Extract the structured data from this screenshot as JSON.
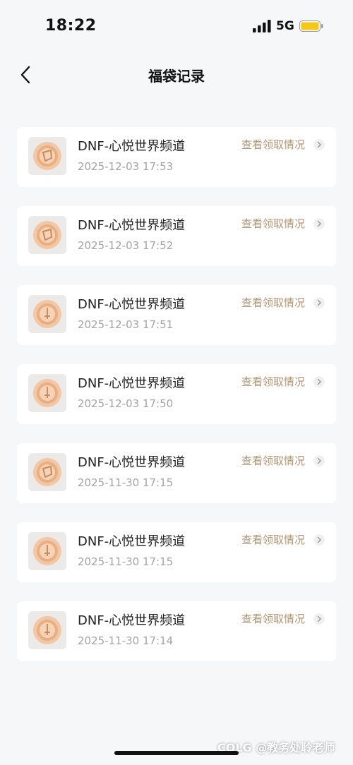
{
  "status_bar": {
    "time": "18:22",
    "network": "5G",
    "icons": [
      "signal-icon",
      "battery-icon"
    ],
    "battery_color": "#f6c61a"
  },
  "nav": {
    "back_icon": "chevron-left-icon",
    "title": "福袋记录"
  },
  "records": [
    {
      "channel": "DNF-心悦世界频道",
      "time": "2025-12-03 17:53",
      "action": "查看领取情况",
      "icon": "coin-icon"
    },
    {
      "channel": "DNF-心悦世界频道",
      "time": "2025-12-03 17:52",
      "action": "查看领取情况",
      "icon": "coin-icon"
    },
    {
      "channel": "DNF-心悦世界频道",
      "time": "2025-12-03 17:51",
      "action": "查看领取情况",
      "icon": "coin-icon"
    },
    {
      "channel": "DNF-心悦世界频道",
      "time": "2025-12-03 17:50",
      "action": "查看领取情况",
      "icon": "coin-icon"
    },
    {
      "channel": "DNF-心悦世界频道",
      "time": "2025-11-30 17:15",
      "action": "查看领取情况",
      "icon": "coin-icon"
    },
    {
      "channel": "DNF-心悦世界频道",
      "time": "2025-11-30 17:15",
      "action": "查看领取情况",
      "icon": "coin-icon"
    },
    {
      "channel": "DNF-心悦世界频道",
      "time": "2025-11-30 17:14",
      "action": "查看领取情况",
      "icon": "coin-icon"
    }
  ],
  "colors": {
    "accent_link": "#b09672",
    "background": "#f6f7f9",
    "card": "#ffffff"
  },
  "watermark": "COLG @教务处聆老师"
}
